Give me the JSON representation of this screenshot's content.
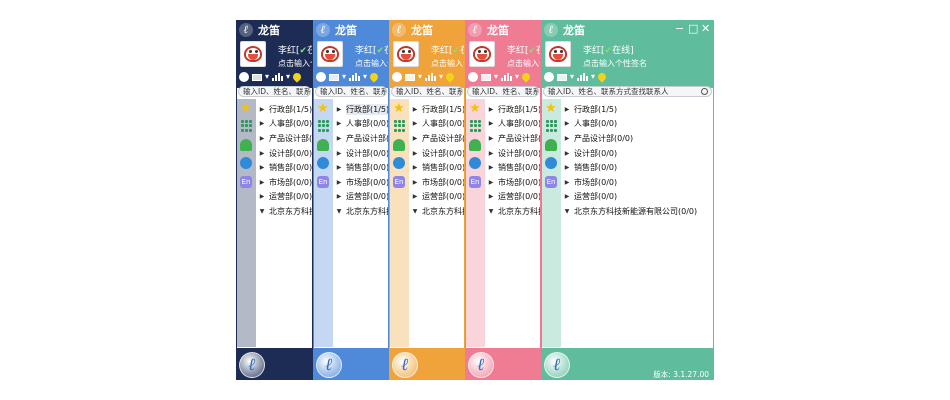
{
  "app": {
    "logo_glyph": "ℓ",
    "title": "龙笛",
    "window_controls": {
      "minimize": "−",
      "maximize": "□",
      "close": "✕"
    }
  },
  "user": {
    "name": "李红",
    "status_open": "[",
    "status_check": "✔",
    "status_text": "在线",
    "status_close": "]",
    "signature_prompt": "点击输入个性签名"
  },
  "search": {
    "placeholder": "输入ID、姓名、联系方式查找联系人"
  },
  "icons": {
    "toolbar": [
      "qq-icon",
      "mail-icon",
      "stats-icon",
      "location-icon"
    ],
    "sidebar": [
      "favorites-star-icon",
      "org-chart-icon",
      "contacts-icon",
      "history-clock-icon",
      "enterprise-icon"
    ]
  },
  "sidebar_en_label": "En",
  "tree": [
    {
      "label": "行政部(1/5)",
      "arrow": "▶"
    },
    {
      "label": "人事部(0/0)",
      "arrow": "▶"
    },
    {
      "label": "产品设计部(0/0)",
      "arrow": "▶"
    },
    {
      "label": "设计部(0/0)",
      "arrow": "▶"
    },
    {
      "label": "销售部(0/0)",
      "arrow": "▶"
    },
    {
      "label": "市场部(0/0)",
      "arrow": "▶"
    },
    {
      "label": "运营部(0/0)",
      "arrow": "▶"
    },
    {
      "label": "北京东方科技新能源有限公司(0/0)",
      "arrow": "▼"
    }
  ],
  "version": "版本: 3.1.27.00",
  "themes": [
    {
      "name": "navy",
      "color": "#1c2c55"
    },
    {
      "name": "blue",
      "color": "#4f89da"
    },
    {
      "name": "orange",
      "color": "#f0a33a"
    },
    {
      "name": "pink",
      "color": "#ef7c93"
    },
    {
      "name": "teal",
      "color": "#5fbd9e"
    }
  ]
}
